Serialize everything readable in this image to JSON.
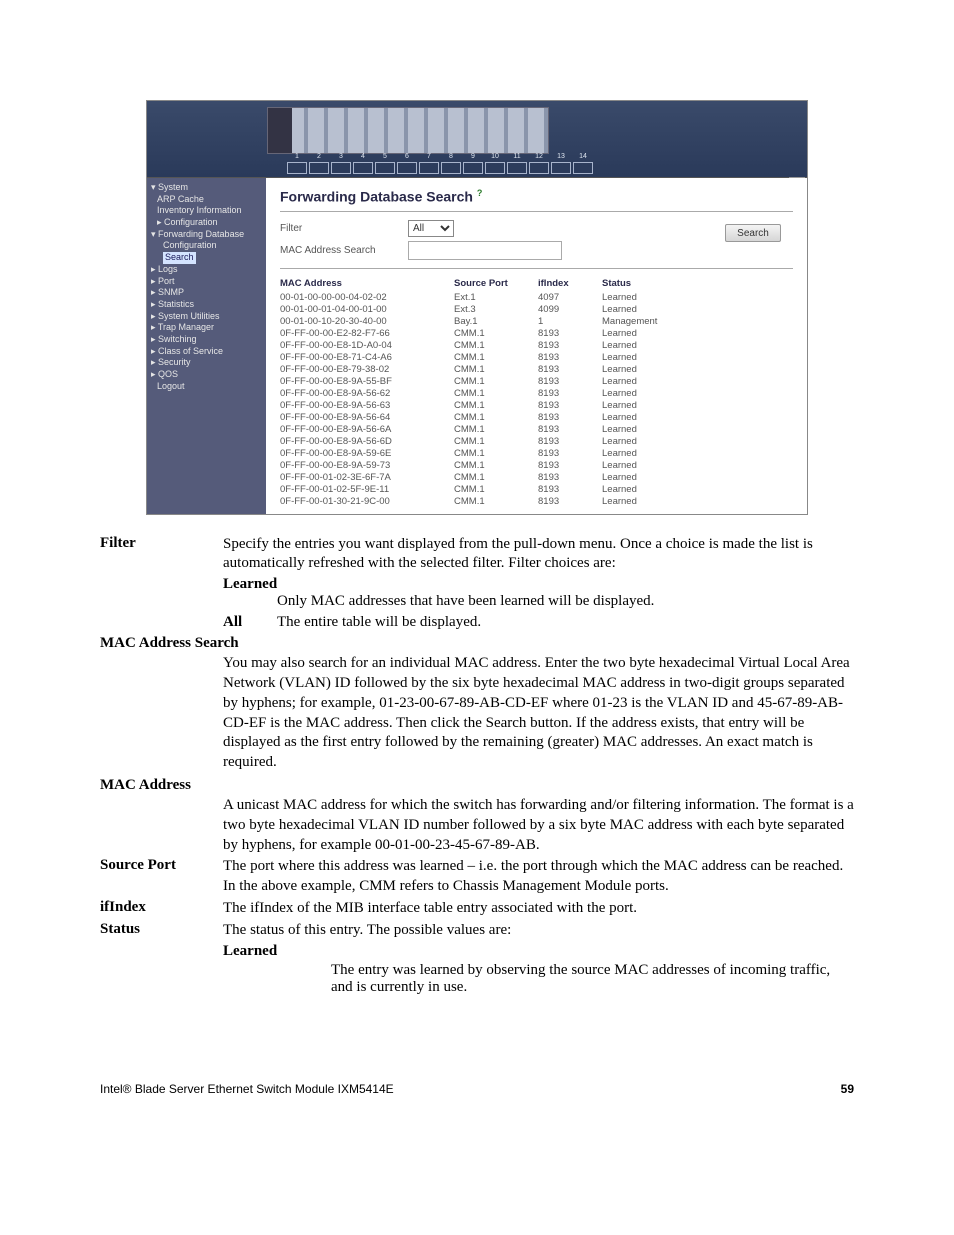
{
  "screenshot": {
    "slots": [
      "1",
      "2",
      "3",
      "4",
      "5",
      "6",
      "7",
      "8",
      "9",
      "10",
      "11",
      "12",
      "13",
      "14"
    ],
    "sidebar": {
      "system": "System",
      "arp": "ARP Cache",
      "inv": "Inventory Information",
      "conf": "Configuration",
      "fdb": "Forwarding Database",
      "conf2": "Configuration",
      "search": "Search",
      "logs": "Logs",
      "port": "Port",
      "snmp": "SNMP",
      "stats": "Statistics",
      "sysutil": "System Utilities",
      "trap": "Trap Manager",
      "switching": "Switching",
      "cos": "Class of Service",
      "security": "Security",
      "qos": "QOS",
      "logout": "Logout"
    },
    "title": "Forwarding Database Search",
    "filter_label": "Filter",
    "filter_value": "All",
    "mac_search_label": "MAC Address Search",
    "search_btn": "Search",
    "headers": {
      "mac": "MAC Address",
      "sp": "Source Port",
      "if": "ifIndex",
      "st": "Status"
    },
    "rows": [
      {
        "mac": "00-01-00-00-00-04-02-02",
        "sp": "Ext.1",
        "if": "4097",
        "st": "Learned"
      },
      {
        "mac": "00-01-00-01-04-00-01-00",
        "sp": "Ext.3",
        "if": "4099",
        "st": "Learned"
      },
      {
        "mac": "00-01-00-10-20-30-40-00",
        "sp": "Bay.1",
        "if": "1",
        "st": "Management"
      },
      {
        "mac": "0F-FF-00-00-E2-82-F7-66",
        "sp": "CMM.1",
        "if": "8193",
        "st": "Learned"
      },
      {
        "mac": "0F-FF-00-00-E8-1D-A0-04",
        "sp": "CMM.1",
        "if": "8193",
        "st": "Learned"
      },
      {
        "mac": "0F-FF-00-00-E8-71-C4-A6",
        "sp": "CMM.1",
        "if": "8193",
        "st": "Learned"
      },
      {
        "mac": "0F-FF-00-00-E8-79-38-02",
        "sp": "CMM.1",
        "if": "8193",
        "st": "Learned"
      },
      {
        "mac": "0F-FF-00-00-E8-9A-55-BF",
        "sp": "CMM.1",
        "if": "8193",
        "st": "Learned"
      },
      {
        "mac": "0F-FF-00-00-E8-9A-56-62",
        "sp": "CMM.1",
        "if": "8193",
        "st": "Learned"
      },
      {
        "mac": "0F-FF-00-00-E8-9A-56-63",
        "sp": "CMM.1",
        "if": "8193",
        "st": "Learned"
      },
      {
        "mac": "0F-FF-00-00-E8-9A-56-64",
        "sp": "CMM.1",
        "if": "8193",
        "st": "Learned"
      },
      {
        "mac": "0F-FF-00-00-E8-9A-56-6A",
        "sp": "CMM.1",
        "if": "8193",
        "st": "Learned"
      },
      {
        "mac": "0F-FF-00-00-E8-9A-56-6D",
        "sp": "CMM.1",
        "if": "8193",
        "st": "Learned"
      },
      {
        "mac": "0F-FF-00-00-E8-9A-59-6E",
        "sp": "CMM.1",
        "if": "8193",
        "st": "Learned"
      },
      {
        "mac": "0F-FF-00-00-E8-9A-59-73",
        "sp": "CMM.1",
        "if": "8193",
        "st": "Learned"
      },
      {
        "mac": "0F-FF-00-01-02-3E-6F-7A",
        "sp": "CMM.1",
        "if": "8193",
        "st": "Learned"
      },
      {
        "mac": "0F-FF-00-01-02-5F-9E-11",
        "sp": "CMM.1",
        "if": "8193",
        "st": "Learned"
      },
      {
        "mac": "0F-FF-00-01-30-21-9C-00",
        "sp": "CMM.1",
        "if": "8193",
        "st": "Learned"
      }
    ]
  },
  "doc": {
    "filter_term": "Filter",
    "filter_body": "Specify the entries you want displayed from the pull-down menu. Once a choice is made the list is automatically refreshed with the selected filter. Filter choices are:",
    "learned_term": "Learned",
    "learned_body": "Only MAC addresses that have been learned will be displayed.",
    "all_term": "All",
    "all_body": "The entire table will be displayed.",
    "mas_term": "MAC Address Search",
    "mas_body": "You may also search for an individual MAC address. Enter the two byte hexadecimal Virtual Local Area Network (VLAN) ID followed by the six byte hexadecimal MAC address in two-digit groups separated by hyphens; for example, 01-23-00-67-89-AB-CD-EF where 01-23 is the VLAN ID and 45-67-89-AB-CD-EF is the MAC address. Then click the Search button. If the address exists, that entry will be displayed as the first entry followed by the remaining (greater) MAC addresses. An exact match is required.",
    "mac_term": "MAC Address",
    "mac_body": "A unicast MAC address for which the switch has forwarding and/or filtering information. The format is a two byte hexadecimal VLAN ID number followed by a six byte MAC address with each byte separated by hyphens, for example 00-01-00-23-45-67-89-AB.",
    "sp_term": "Source Port",
    "sp_body": "The port where this address was learned – i.e. the port through which the MAC address can be reached. In the above example, CMM refers to Chassis Management Module ports.",
    "if_term": "ifIndex",
    "if_body": "The ifIndex of the MIB interface table entry associated with the port.",
    "st_term": "Status",
    "st_body": "The status of this entry. The possible values are:",
    "st_learned_term": "Learned",
    "st_learned_body": "The entry was learned by observing the source MAC addresses of incoming traffic, and is currently in use.",
    "footer_left": "Intel® Blade Server Ethernet Switch Module IXM5414E",
    "footer_right": "59"
  }
}
